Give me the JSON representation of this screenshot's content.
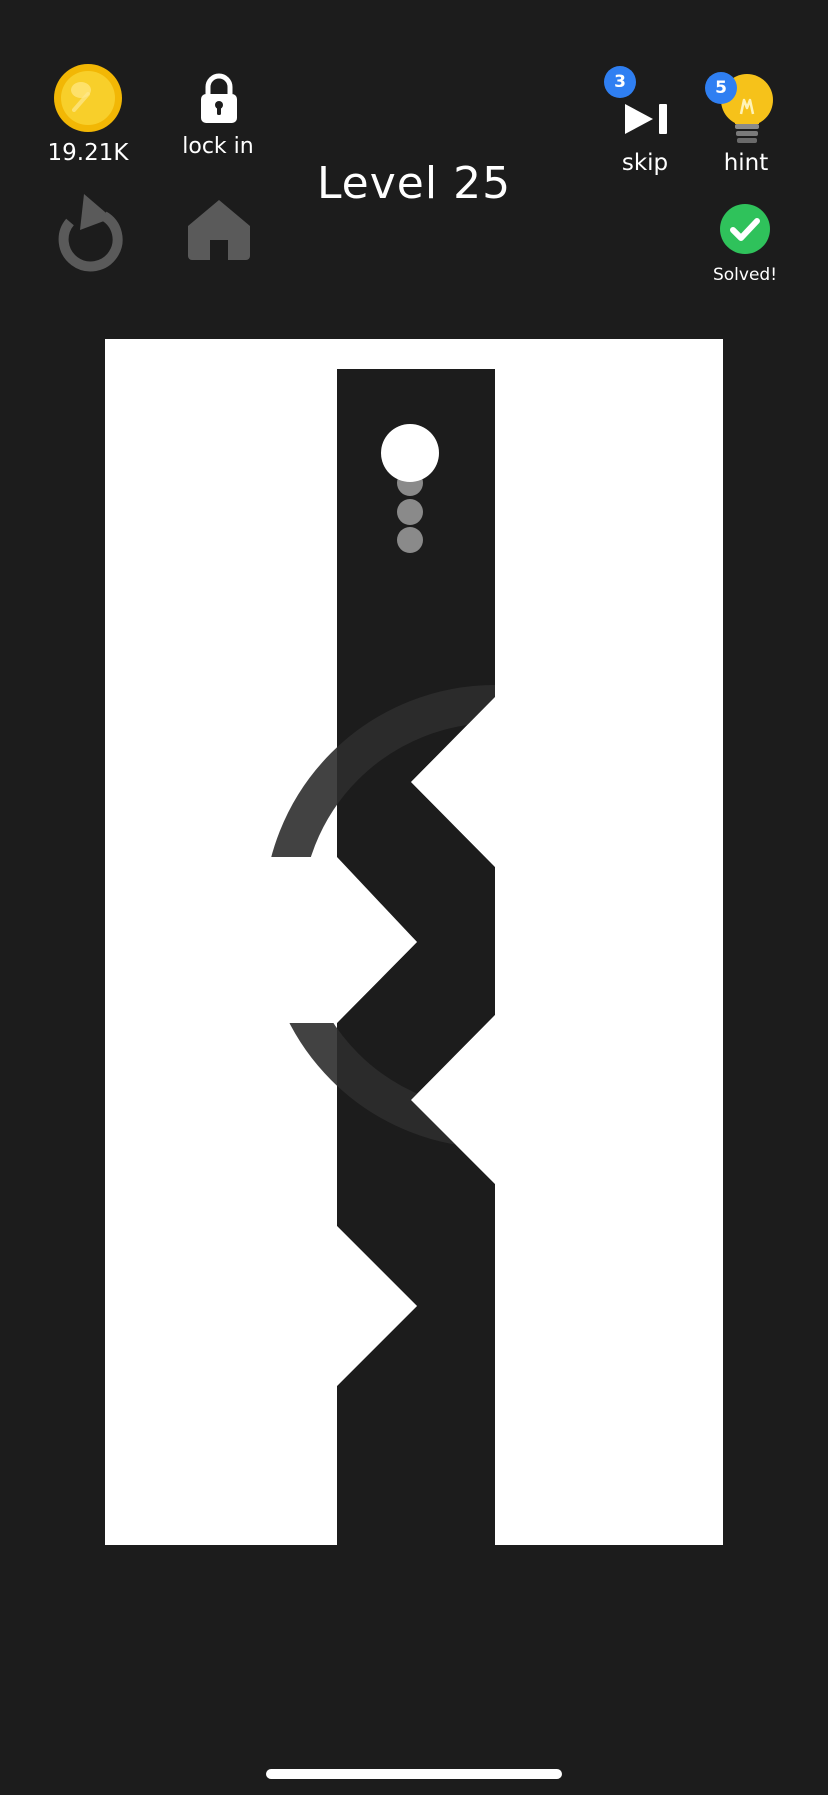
{
  "hud": {
    "coin_icon": "gold-coin-icon",
    "coin_count": "19.21K",
    "lock_label": "lock in",
    "lock_icon": "padlock-icon",
    "restart_icon": "restart-arrow-icon",
    "home_icon": "home-icon",
    "level_title": "Level 25",
    "skip": {
      "label": "skip",
      "icon": "skip-forward-icon",
      "badge": "3"
    },
    "hint": {
      "label": "hint",
      "icon": "lightbulb-icon",
      "badge": "5"
    },
    "solved": {
      "label": "Solved!",
      "icon": "check-circle-icon"
    }
  },
  "colors": {
    "background": "#1c1c1c",
    "board_white": "#ffffff",
    "path_dark": "#1c1c1c",
    "coin_gold": "#f6c21a",
    "badge_blue": "#2f7ff2",
    "solved_green": "#2fc25b",
    "disabled_gray": "#5a5a5a",
    "trail_gray": "#8a8a8a"
  }
}
